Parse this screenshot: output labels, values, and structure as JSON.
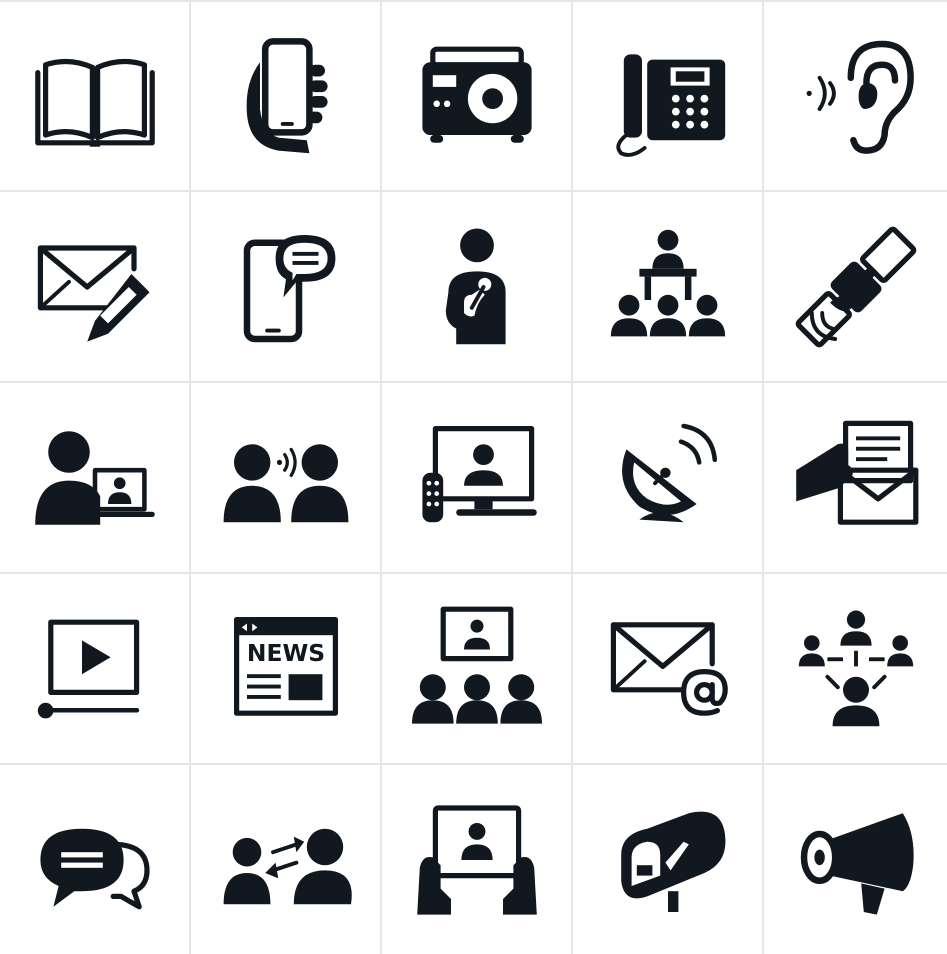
{
  "theme": {
    "ink_color": "#111820",
    "grid_line_color": "#e4e7ea",
    "background": "#ffffff"
  },
  "icons": [
    {
      "name": "open-book-icon"
    },
    {
      "name": "hand-holding-smartphone-icon"
    },
    {
      "name": "radio-icon"
    },
    {
      "name": "desk-phone-icon"
    },
    {
      "name": "ear-listening-icon"
    },
    {
      "name": "envelope-with-pen-icon"
    },
    {
      "name": "smartphone-chat-icon"
    },
    {
      "name": "person-with-microphone-icon"
    },
    {
      "name": "speaker-at-podium-icon"
    },
    {
      "name": "satellite-icon"
    },
    {
      "name": "video-call-icon"
    },
    {
      "name": "two-people-talking-icon"
    },
    {
      "name": "tv-with-remote-icon"
    },
    {
      "name": "satellite-dish-icon"
    },
    {
      "name": "hand-mailing-letter-icon"
    },
    {
      "name": "video-player-icon"
    },
    {
      "name": "news-website-icon"
    },
    {
      "name": "audience-watching-screen-icon"
    },
    {
      "name": "email-at-icon"
    },
    {
      "name": "network-people-icon"
    },
    {
      "name": "speech-bubbles-icon"
    },
    {
      "name": "people-exchange-icon"
    },
    {
      "name": "hands-holding-tablet-icon"
    },
    {
      "name": "mailbox-icon"
    },
    {
      "name": "megaphone-icon"
    }
  ],
  "news_icon": {
    "label": "NEWS"
  }
}
